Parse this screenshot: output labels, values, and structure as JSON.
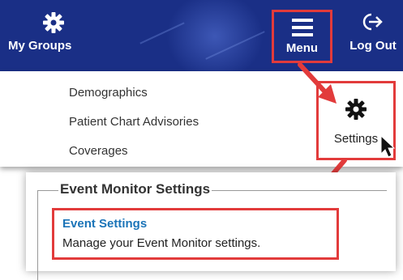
{
  "navbar": {
    "my_groups": "My Groups",
    "menu": "Menu",
    "logout": "Log Out"
  },
  "dropdown": {
    "items": [
      "Demographics",
      "Patient Chart Advisories",
      "Coverages"
    ],
    "settings": "Settings"
  },
  "event_monitor": {
    "legend": "Event Monitor Settings",
    "link": "Event Settings",
    "description": "Manage your Event Monitor settings."
  },
  "colors": {
    "nav_bg": "#1a2f86",
    "highlight": "#e23b3b",
    "link": "#1b74b8"
  },
  "icons": [
    "gear-icon",
    "hamburger-icon",
    "logout-icon",
    "cursor-icon",
    "arrow-icon"
  ]
}
